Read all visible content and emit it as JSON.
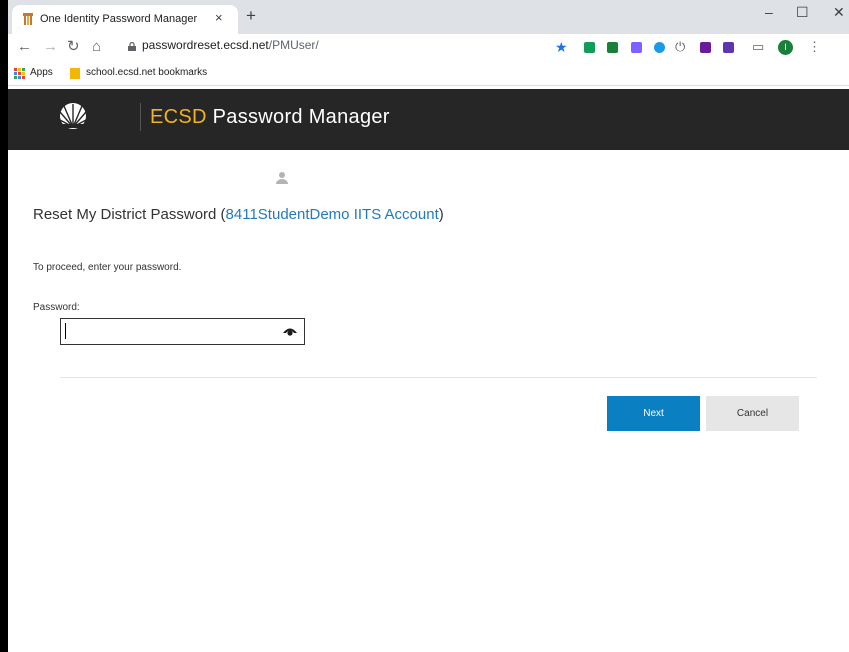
{
  "browser": {
    "tab_title": "One Identity Password Manager",
    "tab_close": "×",
    "new_tab": "+",
    "url_host": "passwordreset.ecsd.net",
    "url_path": "/PMUser/",
    "bookmarks": {
      "apps_label": "Apps",
      "folder_label": "school.ecsd.net bookmarks"
    },
    "profile_initial": "I"
  },
  "header": {
    "brand": "ECSD",
    "title": "Password Manager"
  },
  "main": {
    "title_prefix": "Reset My District Password (",
    "account": "8411StudentDemo IITS Account",
    "title_suffix": ")",
    "instructions": "To proceed, enter your password.",
    "password_label": "Password:",
    "password_value": ""
  },
  "buttons": {
    "next": "Next",
    "cancel": "Cancel"
  },
  "colors": {
    "header_bg": "#262626",
    "brand_accent": "#f0b323",
    "primary_button": "#0a7fc1",
    "link": "#1f7bbf"
  }
}
